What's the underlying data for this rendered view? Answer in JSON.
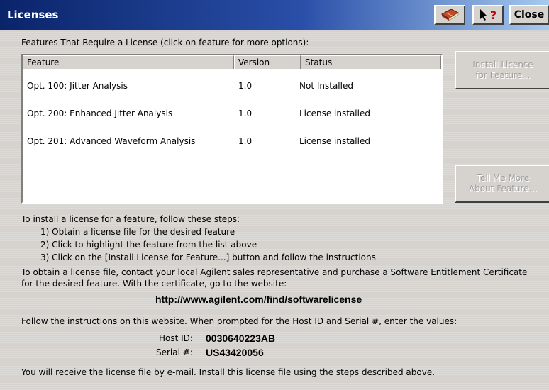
{
  "window": {
    "title": "Licenses",
    "close_label": "Close",
    "help_icon_text": "?"
  },
  "list": {
    "heading": "Features That Require a License (click on feature for more options):",
    "columns": [
      "Feature",
      "Version",
      "Status"
    ],
    "rows": [
      {
        "feature": "Opt. 100: Jitter Analysis",
        "version": "1.0",
        "status": "Not Installed"
      },
      {
        "feature": "Opt. 200: Enhanced Jitter Analysis",
        "version": "1.0",
        "status": "License installed"
      },
      {
        "feature": "Opt. 201: Advanced Waveform Analysis",
        "version": "1.0",
        "status": "License installed"
      }
    ]
  },
  "buttons": {
    "install_label": "Install License\nfor Feature...",
    "tell_more_label": "Tell Me More\nAbout Feature..."
  },
  "instructions": {
    "intro": "To install a license for a feature, follow these steps:",
    "steps": [
      "1) Obtain a license file for the desired feature",
      "2) Click to highlight the feature from the list above",
      "3) Click on the [Install License for Feature...] button and follow the instructions"
    ],
    "obtain_line1": "To obtain a license file, contact your local Agilent sales representative and purchase a Software Entitlement Certificate",
    "obtain_line2": "for the desired feature.  With the certificate, go to the website:",
    "url": "http://www.agilent.com/find/softwarelicense",
    "follow": "Follow the instructions on this website.  When prompted for the Host ID and Serial #, enter the values:",
    "host_id_label": "Host ID:",
    "host_id_value": "0030640223AB",
    "serial_label": "Serial #:",
    "serial_value": "US43420056",
    "final": "You will receive the license file by e-mail.  Install this license file using the steps described above."
  }
}
